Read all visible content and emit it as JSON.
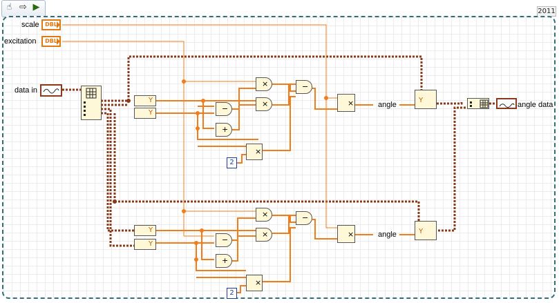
{
  "toolbar": {
    "tools": [
      {
        "icon": "hand-icon",
        "glyph": "☝"
      },
      {
        "icon": "arrow-icon",
        "glyph": "⇨"
      },
      {
        "icon": "run-icon",
        "glyph": "▶"
      }
    ],
    "year": "2011"
  },
  "controls": {
    "scale_label": "scale",
    "excitation_label": "excitation",
    "data_in_label": "data in",
    "dbl_type": "DBL"
  },
  "outputs": {
    "angle_top": "angle",
    "angle_bottom": "angle",
    "angle_data_label": "angle data"
  },
  "constants": {
    "two_top": "2",
    "two_bottom": "2"
  },
  "operators": {
    "multiply": "×",
    "subtract": "−",
    "add": "+",
    "y_port": "Y"
  },
  "colors": {
    "dbl_wire": "#f07d1a",
    "waveform_wire": "#8a3a1a",
    "frame": "#2f6f79"
  }
}
